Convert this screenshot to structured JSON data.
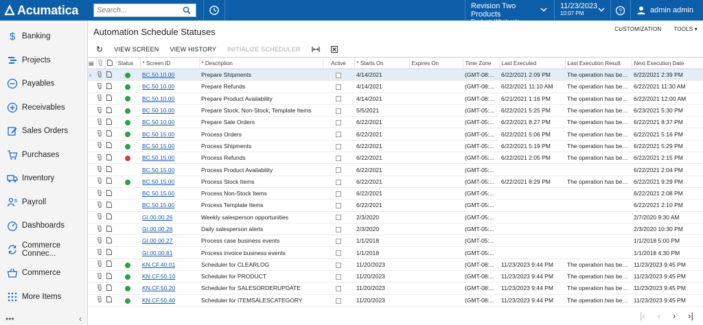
{
  "app": {
    "logo_text": "Acumatica",
    "brand_color": "#0c5ea8"
  },
  "search": {
    "placeholder": "Search..."
  },
  "branch": {
    "company": "Revision Two Products",
    "sub": "Products Wholesale"
  },
  "datetime": {
    "date": "11/23/2023",
    "time": "10:07 PM"
  },
  "user": {
    "name": "admin admin"
  },
  "sidebar": {
    "items": [
      {
        "label": "Banking",
        "icon": "dollar-icon"
      },
      {
        "label": "Projects",
        "icon": "projects-icon"
      },
      {
        "label": "Payables",
        "icon": "minus-circle-icon"
      },
      {
        "label": "Receivables",
        "icon": "plus-circle-icon"
      },
      {
        "label": "Sales Orders",
        "icon": "edit-icon"
      },
      {
        "label": "Purchases",
        "icon": "cart-icon"
      },
      {
        "label": "Inventory",
        "icon": "truck-icon"
      },
      {
        "label": "Payroll",
        "icon": "people-icon"
      },
      {
        "label": "Dashboards",
        "icon": "gauge-icon"
      },
      {
        "label": "Commerce Connec...",
        "icon": "sync-icon"
      },
      {
        "label": "Commerce",
        "icon": "basket-icon"
      },
      {
        "label": "More Items",
        "icon": "grid-icon"
      }
    ],
    "footer_dots": "•••",
    "footer_collapse": "‹"
  },
  "page": {
    "title": "Automation Schedule Statuses"
  },
  "top_links": {
    "customization": "CUSTOMIZATION",
    "tools": "TOOLS"
  },
  "toolbar": {
    "refresh": "↻",
    "view_screen": "VIEW SCREEN",
    "view_history": "VIEW HISTORY",
    "initialize": "INITIALIZE SCHEDULER"
  },
  "columns": {
    "status": "Status",
    "screen_id": "Screen ID",
    "description": "Description",
    "active": "Active",
    "starts_on": "Starts On",
    "expires_on": "Expires On",
    "time_zone": "Time Zone",
    "last_executed": "Last Executed",
    "last_result": "Last Execution Result",
    "next_date": "Next Execution Date"
  },
  "rows": [
    {
      "status": "ok",
      "screen_id": "BC.50.10.00",
      "description": "Prepare Shipments",
      "starts_on": "4/14/2021",
      "time_zone": "(GMT-08:...",
      "last_executed": "6/22/2021 2:09 PM",
      "last_result": "The operation has bee...",
      "next_date": "6/22/2021 2:39 PM"
    },
    {
      "status": "ok",
      "screen_id": "BC.50.10.00",
      "description": "Prepare Refunds",
      "starts_on": "4/14/2021",
      "time_zone": "(GMT-08:...",
      "last_executed": "6/22/2021 11:10 AM",
      "last_result": "The operation has bee...",
      "next_date": "6/22/2021 11:30 AM"
    },
    {
      "status": "ok",
      "screen_id": "BC.50.10.00",
      "description": "Prepare Product Availability",
      "starts_on": "4/14/2021",
      "time_zone": "(GMT-08:...",
      "last_executed": "6/21/2021 1:16 PM",
      "last_result": "The operation has bee...",
      "next_date": "6/22/2021 12:00 AM"
    },
    {
      "status": "ok",
      "screen_id": "BC.50.10.00",
      "description": "Prepare Stock, Non-Stock, Template Items",
      "starts_on": "5/5/2021",
      "time_zone": "(GMT-05:...",
      "last_executed": "6/22/2021 5:25 PM",
      "last_result": "The operation has bee...",
      "next_date": "6/23/2021 5:30 PM"
    },
    {
      "status": "ok",
      "screen_id": "BC.50.10.00",
      "description": "Prepare Sale Orders",
      "starts_on": "6/22/2021",
      "time_zone": "(GMT-05:...",
      "last_executed": "6/22/2021 8:27 PM",
      "last_result": "The operation has bee...",
      "next_date": "6/22/2021 8:37 PM"
    },
    {
      "status": "ok",
      "screen_id": "BC.50.15.00",
      "description": "Process Orders",
      "starts_on": "6/22/2021",
      "time_zone": "(GMT-05:...",
      "last_executed": "6/22/2021 5:06 PM",
      "last_result": "The operation has bee...",
      "next_date": "6/22/2021 5:16 PM"
    },
    {
      "status": "ok",
      "screen_id": "BC.50.15.00",
      "description": "Process Shipments",
      "starts_on": "6/22/2021",
      "time_zone": "(GMT-05:...",
      "last_executed": "6/22/2021 5:19 PM",
      "last_result": "The operation has bee...",
      "next_date": "6/22/2021 5:29 PM"
    },
    {
      "status": "err",
      "screen_id": "BC.50.15.00",
      "description": "Process Refunds",
      "starts_on": "6/22/2021",
      "time_zone": "(GMT-05:...",
      "last_executed": "6/22/2021 2:05 PM",
      "last_result": "The operation has bee...",
      "next_date": "6/22/2021 2:15 PM"
    },
    {
      "status": "",
      "screen_id": "BC.50.15.00",
      "description": "Process Product Availability",
      "starts_on": "6/22/2021",
      "time_zone": "(GMT-05:...",
      "last_executed": "",
      "last_result": "",
      "next_date": "6/22/2021 2:04 PM"
    },
    {
      "status": "ok",
      "screen_id": "BC.50.15.00",
      "description": "Process Stock Items",
      "starts_on": "6/22/2021",
      "time_zone": "(GMT-05:...",
      "last_executed": "6/22/2021 8:29 PM",
      "last_result": "The operation has bee...",
      "next_date": "6/22/2021 9:29 PM"
    },
    {
      "status": "",
      "screen_id": "BC.50.15.00",
      "description": "Process Non-Stock Items",
      "starts_on": "6/22/2021",
      "time_zone": "(GMT-05:...",
      "last_executed": "",
      "last_result": "",
      "next_date": "6/22/2021 2:08 PM"
    },
    {
      "status": "",
      "screen_id": "BC.50.15.00",
      "description": "Process Template Items",
      "starts_on": "6/22/2021",
      "time_zone": "(GMT-05:...",
      "last_executed": "",
      "last_result": "",
      "next_date": "6/22/2021 2:10 PM"
    },
    {
      "status": "",
      "screen_id": "GI.00.00.26",
      "description": "Weekly salesperson opportunities",
      "starts_on": "2/3/2020",
      "time_zone": "(GMT-05:...",
      "last_executed": "",
      "last_result": "",
      "next_date": "2/7/2020 9:30 AM"
    },
    {
      "status": "",
      "screen_id": "GI.00.00.26",
      "description": "Daily salesperson alerts",
      "starts_on": "2/3/2020",
      "time_zone": "(GMT-05:...",
      "last_executed": "",
      "last_result": "",
      "next_date": "2/3/2020 10:30 PM"
    },
    {
      "status": "",
      "screen_id": "GI.00.00.27",
      "description": "Process case business events",
      "starts_on": "1/1/2018",
      "time_zone": "(GMT-05:...",
      "last_executed": "",
      "last_result": "",
      "next_date": "1/1/2018 5:00 PM"
    },
    {
      "status": "",
      "screen_id": "GI.00.00.81",
      "description": "Process invoice business events",
      "starts_on": "1/1/2018",
      "time_zone": "(GMT-05:...",
      "last_executed": "",
      "last_result": "",
      "next_date": "1/1/2018 4:30 PM"
    },
    {
      "status": "ok",
      "screen_id": "KN.CF.40.01",
      "description": "Scheduler for CLEARLOG",
      "starts_on": "11/20/2023",
      "time_zone": "(GMT-08:...",
      "last_executed": "11/23/2023 9:44 PM",
      "last_result": "The operation has bee...",
      "next_date": "11/23/2023 9:45 PM"
    },
    {
      "status": "ok",
      "screen_id": "KN.CF.50.10",
      "description": "Scheduler for PRODUCT",
      "starts_on": "11/20/2023",
      "time_zone": "(GMT-08:...",
      "last_executed": "11/23/2023 9:44 PM",
      "last_result": "The operation has bee...",
      "next_date": "11/23/2023 9:45 PM"
    },
    {
      "status": "ok",
      "screen_id": "KN.CF.50.20",
      "description": "Scheduler for SALESORDERUPDATE",
      "starts_on": "11/20/2023",
      "time_zone": "(GMT-08:...",
      "last_executed": "11/23/2023 9:44 PM",
      "last_result": "The operation has bee...",
      "next_date": "11/23/2023 9:45 PM"
    },
    {
      "status": "ok",
      "screen_id": "KN.CF.50.40",
      "description": "Scheduler for ITEMSALESCATEGORY",
      "starts_on": "11/20/2023",
      "time_zone": "(GMT-08:...",
      "last_executed": "11/23/2023 9:44 PM",
      "last_result": "The operation has bee...",
      "next_date": "11/23/2023 9:45 PM"
    }
  ],
  "pager": {
    "first": "|‹",
    "prev": "‹",
    "next": "›",
    "last": "›|"
  },
  "colors": {
    "ok": "#27a243",
    "err": "#d63b3b",
    "link": "#1a56b0"
  }
}
